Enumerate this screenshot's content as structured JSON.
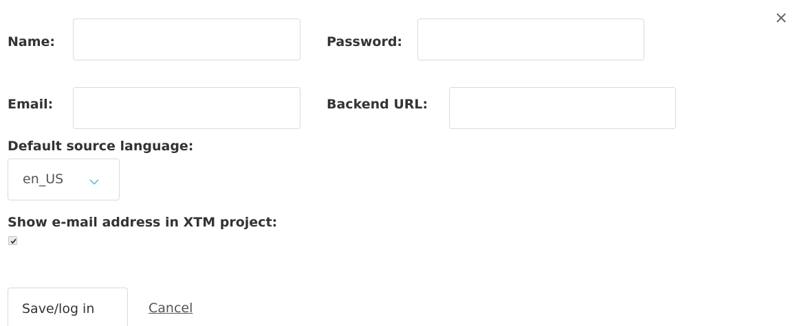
{
  "dialog": {
    "close_icon": "close-icon"
  },
  "form": {
    "name": {
      "label": "Name:",
      "value": ""
    },
    "password": {
      "label": "Password:",
      "value": ""
    },
    "email": {
      "label": "Email:",
      "value": ""
    },
    "backend_url": {
      "label": "Backend URL:",
      "value": ""
    },
    "default_source_language": {
      "label": "Default source language:",
      "selected": "en_US",
      "chevron_icon": "chevron-down-icon"
    },
    "show_email": {
      "label": "Show e-mail address in XTM project:",
      "checked": true
    }
  },
  "actions": {
    "save_label": "Save/log in",
    "cancel_label": "Cancel"
  },
  "colors": {
    "chevron": "#5bc0de",
    "border": "#d9d9d9",
    "text": "#333333"
  }
}
